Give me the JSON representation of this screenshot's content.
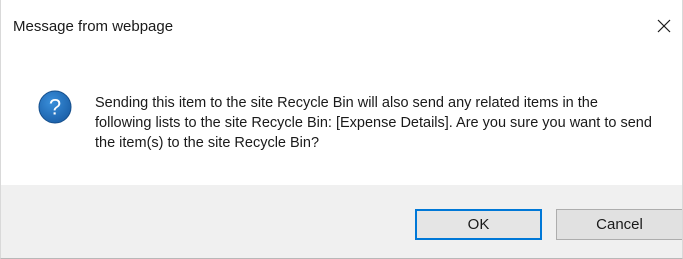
{
  "dialog": {
    "title": "Message from webpage",
    "close_icon": "close-icon",
    "icon": "question-icon",
    "message": "Sending this item to the site Recycle Bin will also send any related items in the following lists to the site Recycle Bin: [Expense Details]. Are you sure you want to send the item(s) to the site Recycle Bin?",
    "ok_label": "OK",
    "cancel_label": "Cancel",
    "colors": {
      "icon_fill": "#1e73be",
      "focus_border": "#0078d7",
      "footer_bg": "#f0f0f0"
    }
  }
}
